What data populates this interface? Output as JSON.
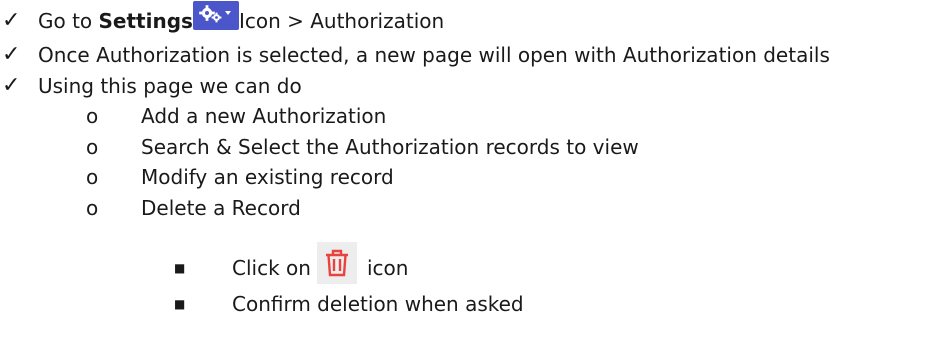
{
  "doc": {
    "line1": {
      "check": "✓",
      "prefix": "Go to ",
      "bold": "Settings",
      "icon": "gear-dropdown-icon",
      "suffix": "Icon > Authorization"
    },
    "line2": {
      "check": "✓",
      "text": "Once Authorization is selected, a new page will open with Authorization details"
    },
    "line3": {
      "check": "✓",
      "text": "Using this page we can do"
    },
    "sub_bullet": "o",
    "sub_items": [
      "Add a new Authorization",
      "Search & Select the Authorization records to view",
      "Modify an existing record",
      "Delete a Record"
    ],
    "square_bullet": "■",
    "steps": {
      "step1_prefix": "Click on",
      "step1_icon": "trash-icon",
      "step1_suffix": "icon",
      "step2": "Confirm deletion when asked"
    },
    "colors": {
      "settings_button": "#4a56c9",
      "trash_icon": "#e8433f",
      "trash_background": "#ededed"
    }
  }
}
